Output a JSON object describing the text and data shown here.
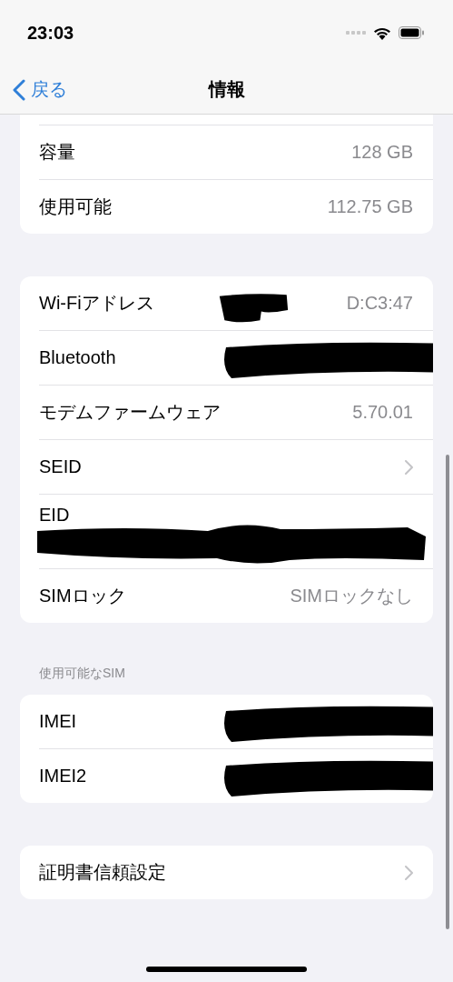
{
  "status_bar": {
    "time": "23:03"
  },
  "nav": {
    "back": "戻る",
    "title": "情報"
  },
  "groups": [
    {
      "kind": "continued",
      "rows": [
        {
          "kind": "value",
          "label": "容量",
          "value": "128 GB"
        },
        {
          "kind": "value",
          "label": "使用可能",
          "value": "112.75 GB"
        }
      ]
    },
    {
      "kind": "section",
      "rows": [
        {
          "kind": "redacted_value",
          "label": "Wi-Fiアドレス",
          "value": "D:C3:47"
        },
        {
          "kind": "redacted",
          "label": "Bluetooth"
        },
        {
          "kind": "value",
          "label": "モデムファームウェア",
          "value": "5.70.01"
        },
        {
          "kind": "link",
          "label": "SEID"
        },
        {
          "kind": "redacted_below",
          "label": "EID"
        },
        {
          "kind": "value",
          "label": "SIMロック",
          "value": "SIMロックなし"
        }
      ]
    },
    {
      "kind": "section",
      "header": "使用可能なSIM",
      "rows": [
        {
          "kind": "redacted",
          "label": "IMEI"
        },
        {
          "kind": "redacted",
          "label": "IMEI2"
        }
      ]
    },
    {
      "kind": "section",
      "rows": [
        {
          "kind": "link",
          "label": "証明書信頼設定"
        }
      ]
    }
  ]
}
